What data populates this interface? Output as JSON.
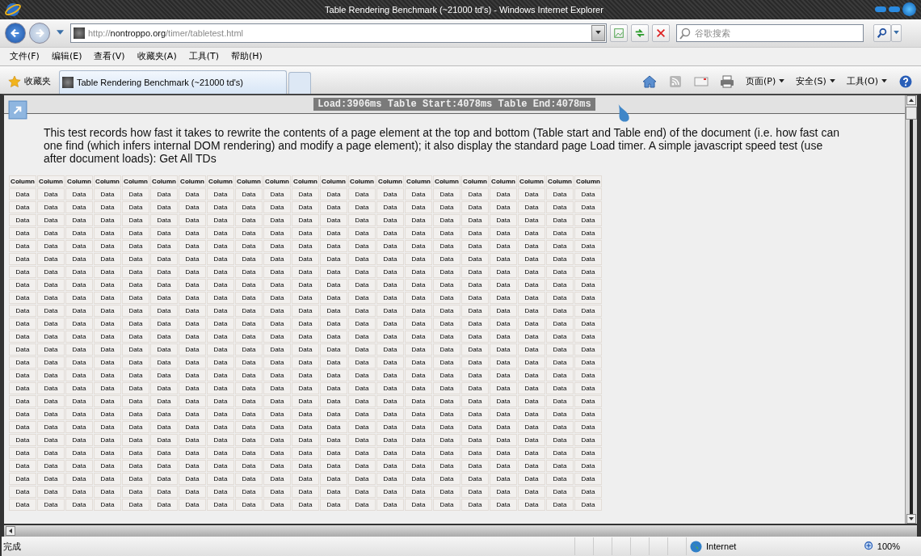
{
  "window": {
    "title": "Table Rendering Benchmark (~21000 td's) - Windows Internet Explorer"
  },
  "address_bar": {
    "url_prefix": "http://",
    "url_domain": "nontroppo.org",
    "url_path": "/timer/tabletest.html"
  },
  "search": {
    "placeholder": "谷歌搜索"
  },
  "menu": [
    "文件(F)",
    "编辑(E)",
    "查看(V)",
    "收藏夹(A)",
    "工具(T)",
    "帮助(H)"
  ],
  "favorites": {
    "label": "收藏夹"
  },
  "tabs": [
    {
      "label": "Table Rendering Benchmark (~21000 td's)",
      "selected": true
    }
  ],
  "command_bar": [
    "页面(P)",
    "安全(S)",
    "工具(O)"
  ],
  "page": {
    "timer": "Load:3906ms Table Start:4078ms Table End:4078ms",
    "description": "This test records how fast it takes to rewrite the contents of a page element at the top and bottom (Table start and Table end) of the document (i.e. how fast can one find (which infers internal DOM rendering) and modify a page element); it also display the standard page Load timer. A simple javascript speed test (use after document loads): Get All TDs",
    "table": {
      "columns": [
        "Column",
        "Column",
        "Column",
        "Column",
        "Column",
        "Column",
        "Column",
        "Column",
        "Column",
        "Column",
        "Column",
        "Column",
        "Column",
        "Column",
        "Column",
        "Column",
        "Column",
        "Column",
        "Column",
        "Column",
        "Column"
      ],
      "rows": [
        [
          "Data",
          "Data",
          "Data",
          "Data",
          "Data",
          "Data",
          "Data",
          "Data",
          "Data",
          "Data",
          "Data",
          "Data",
          "Data",
          "Data",
          "Data",
          "Data",
          "Data",
          "Data",
          "Data",
          "Data",
          "Data"
        ],
        [
          "Data",
          "Data",
          "Data",
          "Data",
          "Data",
          "Data",
          "Data",
          "Data",
          "Data",
          "Data",
          "Data",
          "Data",
          "Data",
          "Data",
          "Data",
          "Data",
          "Data",
          "Data",
          "Data",
          "Data",
          "Data"
        ],
        [
          "Data",
          "Data",
          "Data",
          "Data",
          "Data",
          "Data",
          "Data",
          "Data",
          "Data",
          "Data",
          "Data",
          "Data",
          "Data",
          "Data",
          "Data",
          "Data",
          "Data",
          "Data",
          "Data",
          "Data",
          "Data"
        ],
        [
          "Data",
          "Data",
          "Data",
          "Data",
          "Data",
          "Data",
          "Data",
          "Data",
          "Data",
          "Data",
          "Data",
          "Data",
          "Data",
          "Data",
          "Data",
          "Data",
          "Data",
          "Data",
          "Data",
          "Data",
          "Data"
        ],
        [
          "Data",
          "Data",
          "Data",
          "Data",
          "Data",
          "Data",
          "Data",
          "Data",
          "Data",
          "Data",
          "Data",
          "Data",
          "Data",
          "Data",
          "Data",
          "Data",
          "Data",
          "Data",
          "Data",
          "Data",
          "Data"
        ],
        [
          "Data",
          "Data",
          "Data",
          "Data",
          "Data",
          "Data",
          "Data",
          "Data",
          "Data",
          "Data",
          "Data",
          "Data",
          "Data",
          "Data",
          "Data",
          "Data",
          "Data",
          "Data",
          "Data",
          "Data",
          "Data"
        ],
        [
          "Data",
          "Data",
          "Data",
          "Data",
          "Data",
          "Data",
          "Data",
          "Data",
          "Data",
          "Data",
          "Data",
          "Data",
          "Data",
          "Data",
          "Data",
          "Data",
          "Data",
          "Data",
          "Data",
          "Data",
          "Data"
        ],
        [
          "Data",
          "Data",
          "Data",
          "Data",
          "Data",
          "Data",
          "Data",
          "Data",
          "Data",
          "Data",
          "Data",
          "Data",
          "Data",
          "Data",
          "Data",
          "Data",
          "Data",
          "Data",
          "Data",
          "Data",
          "Data"
        ],
        [
          "Data",
          "Data",
          "Data",
          "Data",
          "Data",
          "Data",
          "Data",
          "Data",
          "Data",
          "Data",
          "Data",
          "Data",
          "Data",
          "Data",
          "Data",
          "Data",
          "Data",
          "Data",
          "Data",
          "Data",
          "Data"
        ],
        [
          "Data",
          "Data",
          "Data",
          "Data",
          "Data",
          "Data",
          "Data",
          "Data",
          "Data",
          "Data",
          "Data",
          "Data",
          "Data",
          "Data",
          "Data",
          "Data",
          "Data",
          "Data",
          "Data",
          "Data",
          "Data"
        ],
        [
          "Data",
          "Data",
          "Data",
          "Data",
          "Data",
          "Data",
          "Data",
          "Data",
          "Data",
          "Data",
          "Data",
          "Data",
          "Data",
          "Data",
          "Data",
          "Data",
          "Data",
          "Data",
          "Data",
          "Data",
          "Data"
        ],
        [
          "Data",
          "Data",
          "Data",
          "Data",
          "Data",
          "Data",
          "Data",
          "Data",
          "Data",
          "Data",
          "Data",
          "Data",
          "Data",
          "Data",
          "Data",
          "Data",
          "Data",
          "Data",
          "Data",
          "Data",
          "Data"
        ],
        [
          "Data",
          "Data",
          "Data",
          "Data",
          "Data",
          "Data",
          "Data",
          "Data",
          "Data",
          "Data",
          "Data",
          "Data",
          "Data",
          "Data",
          "Data",
          "Data",
          "Data",
          "Data",
          "Data",
          "Data",
          "Data"
        ],
        [
          "Data",
          "Data",
          "Data",
          "Data",
          "Data",
          "Data",
          "Data",
          "Data",
          "Data",
          "Data",
          "Data",
          "Data",
          "Data",
          "Data",
          "Data",
          "Data",
          "Data",
          "Data",
          "Data",
          "Data",
          "Data"
        ],
        [
          "Data",
          "Data",
          "Data",
          "Data",
          "Data",
          "Data",
          "Data",
          "Data",
          "Data",
          "Data",
          "Data",
          "Data",
          "Data",
          "Data",
          "Data",
          "Data",
          "Data",
          "Data",
          "Data",
          "Data",
          "Data"
        ],
        [
          "Data",
          "Data",
          "Data",
          "Data",
          "Data",
          "Data",
          "Data",
          "Data",
          "Data",
          "Data",
          "Data",
          "Data",
          "Data",
          "Data",
          "Data",
          "Data",
          "Data",
          "Data",
          "Data",
          "Data",
          "Data"
        ],
        [
          "Data",
          "Data",
          "Data",
          "Data",
          "Data",
          "Data",
          "Data",
          "Data",
          "Data",
          "Data",
          "Data",
          "Data",
          "Data",
          "Data",
          "Data",
          "Data",
          "Data",
          "Data",
          "Data",
          "Data",
          "Data"
        ],
        [
          "Data",
          "Data",
          "Data",
          "Data",
          "Data",
          "Data",
          "Data",
          "Data",
          "Data",
          "Data",
          "Data",
          "Data",
          "Data",
          "Data",
          "Data",
          "Data",
          "Data",
          "Data",
          "Data",
          "Data",
          "Data"
        ],
        [
          "Data",
          "Data",
          "Data",
          "Data",
          "Data",
          "Data",
          "Data",
          "Data",
          "Data",
          "Data",
          "Data",
          "Data",
          "Data",
          "Data",
          "Data",
          "Data",
          "Data",
          "Data",
          "Data",
          "Data",
          "Data"
        ],
        [
          "Data",
          "Data",
          "Data",
          "Data",
          "Data",
          "Data",
          "Data",
          "Data",
          "Data",
          "Data",
          "Data",
          "Data",
          "Data",
          "Data",
          "Data",
          "Data",
          "Data",
          "Data",
          "Data",
          "Data",
          "Data"
        ],
        [
          "Data",
          "Data",
          "Data",
          "Data",
          "Data",
          "Data",
          "Data",
          "Data",
          "Data",
          "Data",
          "Data",
          "Data",
          "Data",
          "Data",
          "Data",
          "Data",
          "Data",
          "Data",
          "Data",
          "Data",
          "Data"
        ],
        [
          "Data",
          "Data",
          "Data",
          "Data",
          "Data",
          "Data",
          "Data",
          "Data",
          "Data",
          "Data",
          "Data",
          "Data",
          "Data",
          "Data",
          "Data",
          "Data",
          "Data",
          "Data",
          "Data",
          "Data",
          "Data"
        ],
        [
          "Data",
          "Data",
          "Data",
          "Data",
          "Data",
          "Data",
          "Data",
          "Data",
          "Data",
          "Data",
          "Data",
          "Data",
          "Data",
          "Data",
          "Data",
          "Data",
          "Data",
          "Data",
          "Data",
          "Data",
          "Data"
        ],
        [
          "Data",
          "Data",
          "Data",
          "Data",
          "Data",
          "Data",
          "Data",
          "Data",
          "Data",
          "Data",
          "Data",
          "Data",
          "Data",
          "Data",
          "Data",
          "Data",
          "Data",
          "Data",
          "Data",
          "Data",
          "Data"
        ],
        [
          "Data",
          "Data",
          "Data",
          "Data",
          "Data",
          "Data",
          "Data",
          "Data",
          "Data",
          "Data",
          "Data",
          "Data",
          "Data",
          "Data",
          "Data",
          "Data",
          "Data",
          "Data",
          "Data",
          "Data",
          "Data"
        ]
      ]
    }
  },
  "status_bar": {
    "text": "完成",
    "zone": "Internet",
    "zoom": "100%"
  }
}
